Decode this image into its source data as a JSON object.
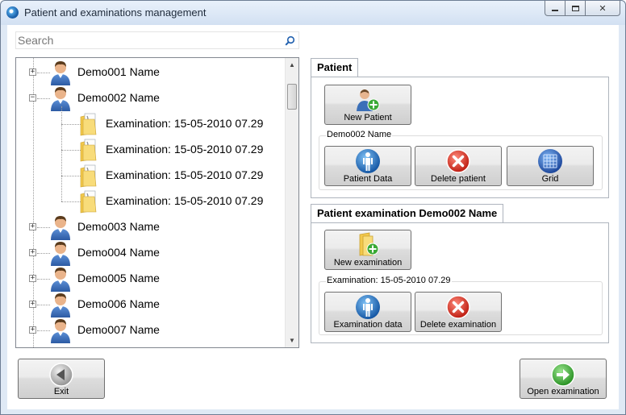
{
  "window": {
    "title": "Patient and examinations management"
  },
  "search": {
    "placeholder": "Search"
  },
  "tree": {
    "patients": [
      {
        "name": "Demo001 Name",
        "expanded": false,
        "examinations": []
      },
      {
        "name": "Demo002 Name",
        "expanded": true,
        "examinations": [
          "Examination: 15-05-2010 07.29",
          "Examination: 15-05-2010 07.29",
          "Examination: 15-05-2010 07.29",
          "Examination: 15-05-2010 07.29"
        ]
      },
      {
        "name": "Demo003 Name",
        "expanded": false,
        "examinations": []
      },
      {
        "name": "Demo004 Name",
        "expanded": false,
        "examinations": []
      },
      {
        "name": "Demo005 Name",
        "expanded": false,
        "examinations": []
      },
      {
        "name": "Demo006 Name",
        "expanded": false,
        "examinations": []
      },
      {
        "name": "Demo007 Name",
        "expanded": false,
        "examinations": []
      }
    ],
    "expand_glyph": "+",
    "collapse_glyph": "−",
    "scroll_position": 0.05
  },
  "patient_panel": {
    "tab_label": "Patient",
    "new_patient_label": "New Patient",
    "group_title": "Demo002 Name",
    "patient_data_label": "Patient Data",
    "delete_patient_label": "Delete patient",
    "grid_label": "Grid"
  },
  "exam_panel": {
    "tab_label": "Patient examination Demo002 Name",
    "new_exam_label": "New examination",
    "group_title": "Examination: 15-05-2010 07.29",
    "exam_data_label": "Examination data",
    "delete_exam_label": "Delete examination"
  },
  "footer": {
    "exit_label": "Exit",
    "open_exam_label": "Open examination"
  },
  "colors": {
    "accent_blue": "#1f6fc4",
    "delete_red": "#d8291e",
    "ok_green": "#3aa935",
    "folder_yellow": "#f2c84b"
  },
  "icons": {
    "app": "app-icon",
    "search": "search-icon",
    "patient": "person-icon",
    "examination": "folder-document-icon",
    "new_patient": "add-person-icon",
    "patient_data": "person-info-icon",
    "delete": "delete-x-icon",
    "grid": "grid-icon",
    "new_exam": "add-folder-icon",
    "exit": "back-arrow-icon",
    "open": "forward-arrow-icon"
  }
}
